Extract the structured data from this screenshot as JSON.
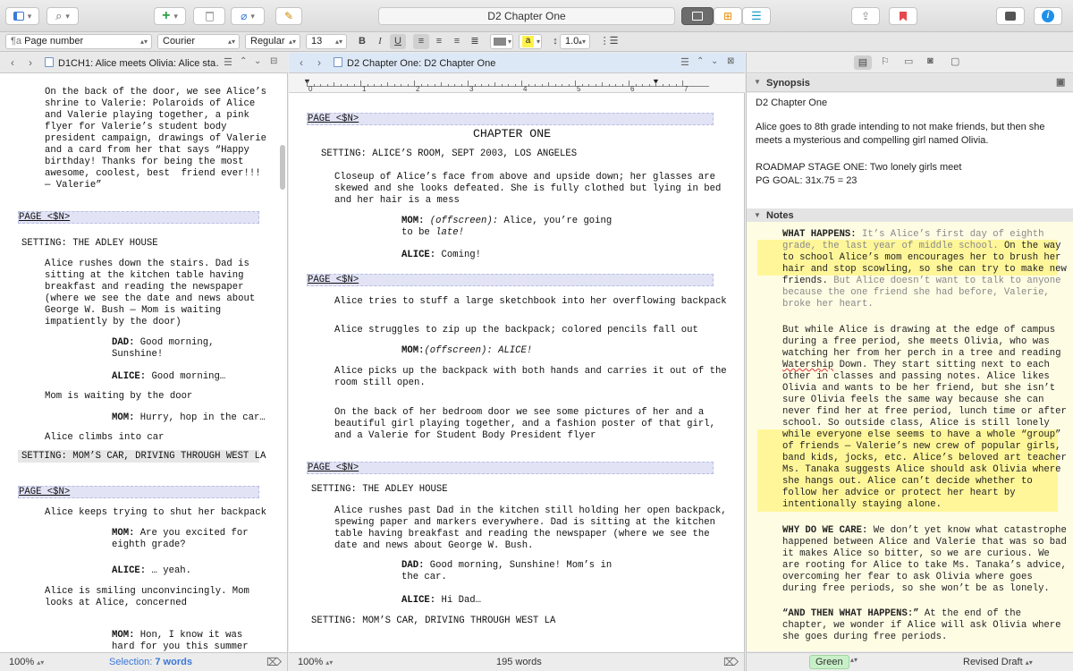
{
  "toolbar": {
    "title": "D2 Chapter One"
  },
  "format_bar": {
    "style": "Page number",
    "font": "Courier",
    "weight": "Regular",
    "size": "13",
    "bold": "B",
    "italic": "I",
    "underline": "U",
    "highlight_label": "a",
    "line_spacing": "1.0"
  },
  "left_pane": {
    "breadcrumb": "D1CH1: Alice meets Olivia:",
    "breadcrumb_rest": "Alice sta…",
    "lines": [
      "On the back of the door, we see Alice’s",
      "shrine to Valerie: Polaroids of Alice",
      "and Valerie playing together, a pink",
      "flyer for Valerie’s student body",
      "president campaign, drawings of Valerie",
      "and a card from her that says “Happy",
      "birthday! Thanks for being the most",
      "awesome, coolest, best  friend ever!!!",
      "— Valerie”",
      "PAGE <$N>",
      "SETTING: THE ADLEY HOUSE",
      "Alice rushes down the stairs. Dad is",
      "sitting at the kitchen table having",
      "breakfast and reading the newspaper",
      "(where we see the date and news about",
      "George W. Bush — Mom is waiting",
      "impatiently by the door)",
      "DAD:",
      " Good morning,",
      "Sunshine!",
      "ALICE:",
      " Good morning…",
      "Mom is waiting by the door",
      "MOM:",
      " Hurry, hop in the car…",
      "Alice climbs into car",
      "SETTING: MOM’S CAR, DRIVING THROUGH WEST LA",
      "PAGE <$N>",
      "Alice keeps trying to shut her backpack",
      "MOM:",
      " Are you excited for",
      "eighth grade?",
      "ALICE:",
      " … yeah.",
      "Alice is smiling unconvincingly. Mom",
      "looks at Alice, concerned",
      "MOM:",
      " Hon, I know it was",
      "hard for you this summer"
    ],
    "zoom": "100%",
    "selection_label": "Selection:",
    "selection_value": "7 words"
  },
  "center_pane": {
    "breadcrumb": "D2 Chapter One:",
    "breadcrumb_rest": "D2 Chapter One",
    "ruler": [
      "0",
      "1",
      "2",
      "3",
      "4",
      "5",
      "6",
      "7"
    ],
    "page1": "PAGE <$N>",
    "chapter_title": "CHAPTER ONE",
    "setting1": "SETTING: ALICE’S ROOM, SEPT 2003, LOS ANGELES",
    "action1": [
      "Closeup of Alice’s face from above and upside down; her glasses are",
      "skewed and she looks defeated. She is fully clothed but lying in bed",
      "and her hair is a mess"
    ],
    "mom1_name": "MOM:",
    "mom1_paren": " (offscreen):",
    "mom1_a": " Alice, you’re going",
    "mom1_b": "to be ",
    "mom1_late": "late!",
    "alice1_name": "ALICE:",
    "alice1_line": " Coming!",
    "page2": "PAGE <$N>",
    "action2": "Alice tries to stuff a large sketchbook into her overflowing backpack",
    "action3": "Alice struggles to zip up the backpack; colored pencils fall out",
    "mom2_name": "MOM:",
    "mom2_paren": "(offscreen):",
    "mom2_line": " ALICE!",
    "action4": [
      "Alice picks up the backpack with both hands and carries it out of the",
      "room still open."
    ],
    "action5": [
      "On the back of her bedroom door we see some pictures of her and a",
      "beautiful girl playing together, and a fashion poster of that girl,",
      "and a Valerie for Student Body President flyer"
    ],
    "page3": "PAGE <$N>",
    "setting2": "SETTING: THE ADLEY HOUSE",
    "action6": [
      "Alice rushes past Dad in the kitchen still holding her open backpack,",
      "spewing paper and markers everywhere. Dad is sitting at the kitchen",
      "table having breakfast and reading the newspaper (where we see the",
      "date and news about George W. Bush."
    ],
    "dad_name": "DAD:",
    "dad_a": " Good morning, Sunshine! Mom’s in",
    "dad_b": "the car.",
    "alice2_name": "ALICE:",
    "alice2_line": " Hi Dad…",
    "setting3": "SETTING: MOM’S CAR, DRIVING THROUGH WEST LA",
    "zoom": "100%",
    "word_count": "195 words"
  },
  "inspector": {
    "synopsis_label": "Synopsis",
    "synopsis_title": "D2 Chapter One",
    "synopsis_text": [
      "Alice goes to 8th grade intending to not make friends, but then she",
      "meets a mysterious and compelling girl named Olivia."
    ],
    "roadmap": "ROADMAP STAGE ONE: Two lonely girls meet",
    "pg_goal": "PG GOAL: 31x.75 = 23",
    "notes_label": "Notes",
    "notes_lines": [
      "WHAT HAPPENS:",
      " It’s Alice’s first day of eighth",
      "grade, the last year of middle school. ",
      "On the way",
      "to school Alice’s mom encourages her to brush her",
      "hair and stop scowling, so she can try to make new",
      "friends.",
      " But Alice doesn’t want to talk to anyone",
      "because the one friend she had before, Valerie,",
      "broke her heart.",
      "But while Alice is drawing at the edge of campus",
      "during a free period, she meets Olivia, who was",
      "watching her from her perch in a tree and reading",
      "Watership",
      " Down. They start sitting next to each",
      "other in classes and passing notes. Alice likes",
      "Olivia and wants to be her friend, but she isn’t",
      "sure Olivia feels the same way because she can",
      "never find her at free period, lunch time or after",
      "school. So outside class, Alice is still lonely",
      "while everyone else seems to have a whole “group”",
      "of friends — Valerie’s new crew of popular girls,",
      "band kids, jocks, etc. Alice’s beloved art teacher",
      "Ms. Tanaka suggests Alice should ask Olivia where",
      "she hangs out. Alice can’t decide whether to",
      "follow her advice or protect her heart by",
      "intentionally staying alone.",
      "WHY DO WE CARE:",
      " We don’t yet know what catastrophe",
      "happened between Alice and Valerie that was so bad",
      "it makes Alice so bitter, so we are curious. We",
      "are rooting for Alice to take Ms. Tanaka’s advice,",
      "overcoming her fear to ask Olivia where goes",
      "during free periods, so she won’t be as lonely.",
      "“AND THEN WHAT HAPPENS:”",
      " At the end of the",
      "chapter, we wonder if Alice will ask Olivia where",
      "she goes during free periods."
    ],
    "label": "Green",
    "status": "Revised Draft"
  },
  "colors": {
    "highlight": "#fff69a",
    "notes_bg": "#fffce4",
    "label_green": "#c8f0c8",
    "page_marker": "#e2e4f6"
  }
}
